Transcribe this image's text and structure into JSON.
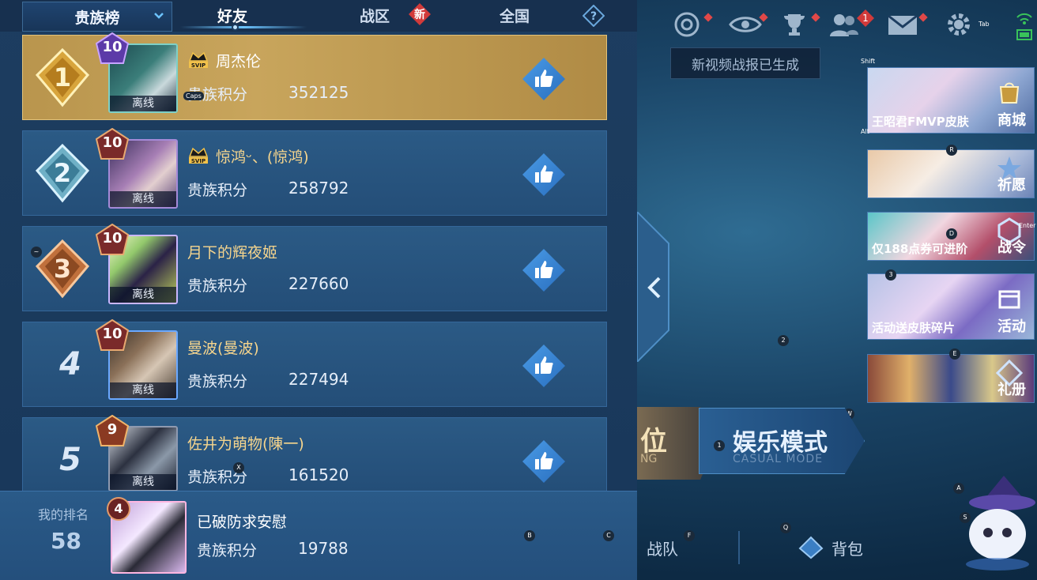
{
  "tabs": {
    "dropdown": "贵族榜",
    "friends": "好友",
    "region": "战区",
    "new_badge": "新",
    "national": "全国"
  },
  "rows": [
    {
      "rank": "1",
      "level": "10",
      "name": "周杰伦",
      "svip": "SVIP",
      "status": "离线",
      "score_label": "贵族积分",
      "score": "352125"
    },
    {
      "rank": "2",
      "level": "10",
      "name": "惊鸿ᵕ、(惊鸿)",
      "svip": "SVIP",
      "status": "离线",
      "score_label": "贵族积分",
      "score": "258792"
    },
    {
      "rank": "3",
      "level": "10",
      "name": "月下的辉夜姬",
      "status": "离线",
      "score_label": "贵族积分",
      "score": "227660"
    },
    {
      "rank": "4",
      "level": "10",
      "name": "曼波(曼波)",
      "status": "离线",
      "score_label": "贵族积分",
      "score": "227494"
    },
    {
      "rank": "5",
      "level": "9",
      "name": "佐井为萌物(陳一)",
      "status": "离线",
      "score_label": "贵族积分",
      "score": "161520"
    }
  ],
  "my_rank": {
    "label": "我的排名",
    "rank": "58",
    "level": "4",
    "name": "已破防求安慰",
    "score_label": "贵族积分",
    "score": "19788"
  },
  "right": {
    "banner": "新视频战报已生成",
    "mail_badge": "1",
    "tab_key": "Tab",
    "cards": [
      {
        "caption": "王昭君FMVP皮肤",
        "label": "商城"
      },
      {
        "caption": "",
        "label": "祈愿"
      },
      {
        "caption": "仅188点券可进阶",
        "label": "战令"
      },
      {
        "caption": "活动送皮肤碎片",
        "label": "活动"
      },
      {
        "caption": "",
        "label": "礼册"
      }
    ],
    "mode_left": "位",
    "mode_left_sub": "NG",
    "mode_title": "娱乐模式",
    "mode_sub": "CASUAL MODE",
    "team": "战队",
    "bag": "背包"
  },
  "key_hints": {
    "caps": "Caps",
    "tilde": "~",
    "shift": "Shift",
    "alt": "Alt",
    "enter": "Enter",
    "r": "R",
    "d": "D",
    "k3": "3",
    "k2": "2",
    "e": "E",
    "w": "W",
    "k1": "1",
    "x": "X",
    "a": "A",
    "s": "S",
    "b": "B",
    "c": "C",
    "f": "F",
    "q": "Q"
  },
  "colors": {
    "accent": "#6cc4ff",
    "gold_row": "#c8a55c",
    "name_gold": "#f4d07a",
    "like": "#3d8ad8",
    "red_dot": "#e04848"
  }
}
